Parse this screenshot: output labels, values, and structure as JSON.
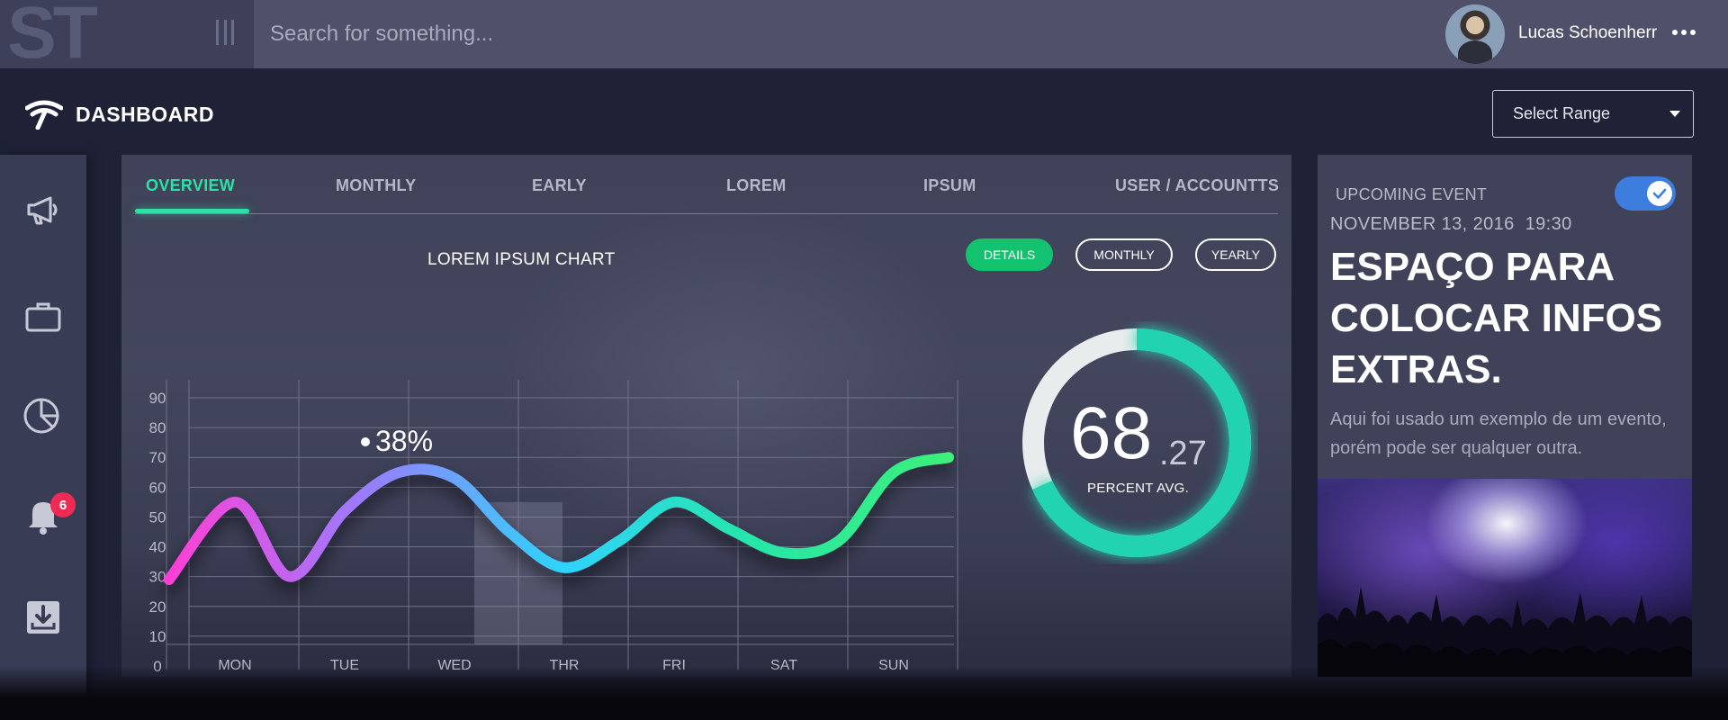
{
  "topbar": {
    "logo_text": "ST",
    "search_placeholder": "Search for something...",
    "user_name": "Lucas Schoenherr"
  },
  "header": {
    "title": "DASHBOARD",
    "range_select": "Select Range"
  },
  "sidebar": {
    "items": [
      {
        "icon": "megaphone-icon"
      },
      {
        "icon": "briefcase-icon"
      },
      {
        "icon": "pie-chart-icon"
      },
      {
        "icon": "bell-icon",
        "badge": "6"
      },
      {
        "icon": "download-tray-icon"
      }
    ]
  },
  "main": {
    "tabs": [
      {
        "label": "OVERVIEW",
        "active": true
      },
      {
        "label": "MONTHLY"
      },
      {
        "label": "EARLY"
      },
      {
        "label": "LOREM"
      },
      {
        "label": "IPSUM"
      },
      {
        "label": "USER / ACCOUNTTS"
      }
    ],
    "chart_title": "LOREM IPSUM CHART",
    "buttons": {
      "details": "DETAILS",
      "monthly": "MONTHLY",
      "yearly": "YEARLY"
    },
    "donut": {
      "value_int": "68",
      "value_dec": ".27",
      "label": "PERCENT AVG.",
      "percent": 68.27
    }
  },
  "chart_data": {
    "type": "line",
    "title": "LOREM IPSUM CHART",
    "categories": [
      "MON",
      "TUE",
      "WED",
      "THR",
      "FRI",
      "SAT",
      "SUN"
    ],
    "x": [
      -0.6,
      0.0,
      0.5,
      1.0,
      1.5,
      2.0,
      2.5,
      3.0,
      3.5,
      4.0,
      4.5,
      5.0,
      5.5,
      6.0,
      6.5
    ],
    "values": [
      29,
      55,
      30,
      52,
      65,
      63,
      45,
      33,
      42,
      55,
      46,
      38,
      42,
      65,
      70
    ],
    "yticks": [
      0,
      10,
      20,
      30,
      40,
      50,
      60,
      70,
      80,
      90
    ],
    "ylim": [
      0,
      90
    ],
    "highlight": {
      "category": "WED",
      "label": "38%"
    },
    "gradient_colors": [
      "#ff3fd6",
      "#9a7cff",
      "#2fd3ff",
      "#27e6a8",
      "#3cf07a"
    ],
    "grid": true
  },
  "event": {
    "label": "UPCOMING EVENT",
    "date": "NOVEMBER 13, 2016  19:30",
    "heading": "ESPAÇO PARA COLOCAR INFOS EXTRAS.",
    "description": "Aqui foi usado um exemplo de um evento, porém pode ser qualquer outra.",
    "toggle_on": true
  },
  "colors": {
    "accent": "#2ee0a5",
    "details_button": "#13c26e",
    "toggle": "#3d7dde",
    "badge": "#ee2a55",
    "donut": "#23d3b0"
  }
}
